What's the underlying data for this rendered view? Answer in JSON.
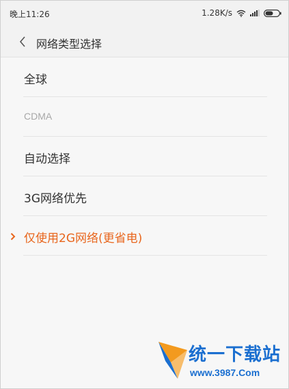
{
  "status_bar": {
    "time": "晚上11:26",
    "network_speed": "1.28K/s",
    "icons": [
      "wifi-icon",
      "signal-icon",
      "battery-icon"
    ]
  },
  "header": {
    "title": "网络类型选择",
    "back_icon": "chevron-left-icon"
  },
  "options": [
    {
      "label": "全球",
      "state": "normal"
    },
    {
      "label": "CDMA",
      "state": "disabled"
    },
    {
      "label": "自动选择",
      "state": "normal"
    },
    {
      "label": "3G网络优先",
      "state": "normal"
    },
    {
      "label": "仅使用2G网络(更省电)",
      "state": "selected"
    }
  ],
  "watermark": {
    "title": "统一下载站",
    "url": "www.3987.Com"
  },
  "colors": {
    "accent": "#e8661d",
    "text": "#333333",
    "disabled_text": "#a8a8a8",
    "background": "#f7f7f7",
    "watermark_blue": "#1b6fd0"
  }
}
